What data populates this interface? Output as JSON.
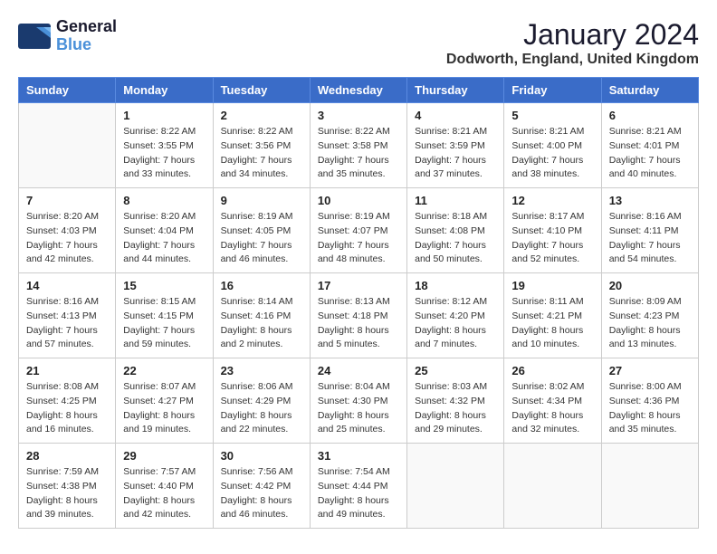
{
  "header": {
    "logo_line1": "General",
    "logo_line2": "Blue",
    "month": "January 2024",
    "location": "Dodworth, England, United Kingdom"
  },
  "days_of_week": [
    "Sunday",
    "Monday",
    "Tuesday",
    "Wednesday",
    "Thursday",
    "Friday",
    "Saturday"
  ],
  "weeks": [
    [
      {
        "day": "",
        "info": ""
      },
      {
        "day": "1",
        "info": "Sunrise: 8:22 AM\nSunset: 3:55 PM\nDaylight: 7 hours\nand 33 minutes."
      },
      {
        "day": "2",
        "info": "Sunrise: 8:22 AM\nSunset: 3:56 PM\nDaylight: 7 hours\nand 34 minutes."
      },
      {
        "day": "3",
        "info": "Sunrise: 8:22 AM\nSunset: 3:58 PM\nDaylight: 7 hours\nand 35 minutes."
      },
      {
        "day": "4",
        "info": "Sunrise: 8:21 AM\nSunset: 3:59 PM\nDaylight: 7 hours\nand 37 minutes."
      },
      {
        "day": "5",
        "info": "Sunrise: 8:21 AM\nSunset: 4:00 PM\nDaylight: 7 hours\nand 38 minutes."
      },
      {
        "day": "6",
        "info": "Sunrise: 8:21 AM\nSunset: 4:01 PM\nDaylight: 7 hours\nand 40 minutes."
      }
    ],
    [
      {
        "day": "7",
        "info": "Sunrise: 8:20 AM\nSunset: 4:03 PM\nDaylight: 7 hours\nand 42 minutes."
      },
      {
        "day": "8",
        "info": "Sunrise: 8:20 AM\nSunset: 4:04 PM\nDaylight: 7 hours\nand 44 minutes."
      },
      {
        "day": "9",
        "info": "Sunrise: 8:19 AM\nSunset: 4:05 PM\nDaylight: 7 hours\nand 46 minutes."
      },
      {
        "day": "10",
        "info": "Sunrise: 8:19 AM\nSunset: 4:07 PM\nDaylight: 7 hours\nand 48 minutes."
      },
      {
        "day": "11",
        "info": "Sunrise: 8:18 AM\nSunset: 4:08 PM\nDaylight: 7 hours\nand 50 minutes."
      },
      {
        "day": "12",
        "info": "Sunrise: 8:17 AM\nSunset: 4:10 PM\nDaylight: 7 hours\nand 52 minutes."
      },
      {
        "day": "13",
        "info": "Sunrise: 8:16 AM\nSunset: 4:11 PM\nDaylight: 7 hours\nand 54 minutes."
      }
    ],
    [
      {
        "day": "14",
        "info": "Sunrise: 8:16 AM\nSunset: 4:13 PM\nDaylight: 7 hours\nand 57 minutes."
      },
      {
        "day": "15",
        "info": "Sunrise: 8:15 AM\nSunset: 4:15 PM\nDaylight: 7 hours\nand 59 minutes."
      },
      {
        "day": "16",
        "info": "Sunrise: 8:14 AM\nSunset: 4:16 PM\nDaylight: 8 hours\nand 2 minutes."
      },
      {
        "day": "17",
        "info": "Sunrise: 8:13 AM\nSunset: 4:18 PM\nDaylight: 8 hours\nand 5 minutes."
      },
      {
        "day": "18",
        "info": "Sunrise: 8:12 AM\nSunset: 4:20 PM\nDaylight: 8 hours\nand 7 minutes."
      },
      {
        "day": "19",
        "info": "Sunrise: 8:11 AM\nSunset: 4:21 PM\nDaylight: 8 hours\nand 10 minutes."
      },
      {
        "day": "20",
        "info": "Sunrise: 8:09 AM\nSunset: 4:23 PM\nDaylight: 8 hours\nand 13 minutes."
      }
    ],
    [
      {
        "day": "21",
        "info": "Sunrise: 8:08 AM\nSunset: 4:25 PM\nDaylight: 8 hours\nand 16 minutes."
      },
      {
        "day": "22",
        "info": "Sunrise: 8:07 AM\nSunset: 4:27 PM\nDaylight: 8 hours\nand 19 minutes."
      },
      {
        "day": "23",
        "info": "Sunrise: 8:06 AM\nSunset: 4:29 PM\nDaylight: 8 hours\nand 22 minutes."
      },
      {
        "day": "24",
        "info": "Sunrise: 8:04 AM\nSunset: 4:30 PM\nDaylight: 8 hours\nand 25 minutes."
      },
      {
        "day": "25",
        "info": "Sunrise: 8:03 AM\nSunset: 4:32 PM\nDaylight: 8 hours\nand 29 minutes."
      },
      {
        "day": "26",
        "info": "Sunrise: 8:02 AM\nSunset: 4:34 PM\nDaylight: 8 hours\nand 32 minutes."
      },
      {
        "day": "27",
        "info": "Sunrise: 8:00 AM\nSunset: 4:36 PM\nDaylight: 8 hours\nand 35 minutes."
      }
    ],
    [
      {
        "day": "28",
        "info": "Sunrise: 7:59 AM\nSunset: 4:38 PM\nDaylight: 8 hours\nand 39 minutes."
      },
      {
        "day": "29",
        "info": "Sunrise: 7:57 AM\nSunset: 4:40 PM\nDaylight: 8 hours\nand 42 minutes."
      },
      {
        "day": "30",
        "info": "Sunrise: 7:56 AM\nSunset: 4:42 PM\nDaylight: 8 hours\nand 46 minutes."
      },
      {
        "day": "31",
        "info": "Sunrise: 7:54 AM\nSunset: 4:44 PM\nDaylight: 8 hours\nand 49 minutes."
      },
      {
        "day": "",
        "info": ""
      },
      {
        "day": "",
        "info": ""
      },
      {
        "day": "",
        "info": ""
      }
    ]
  ]
}
